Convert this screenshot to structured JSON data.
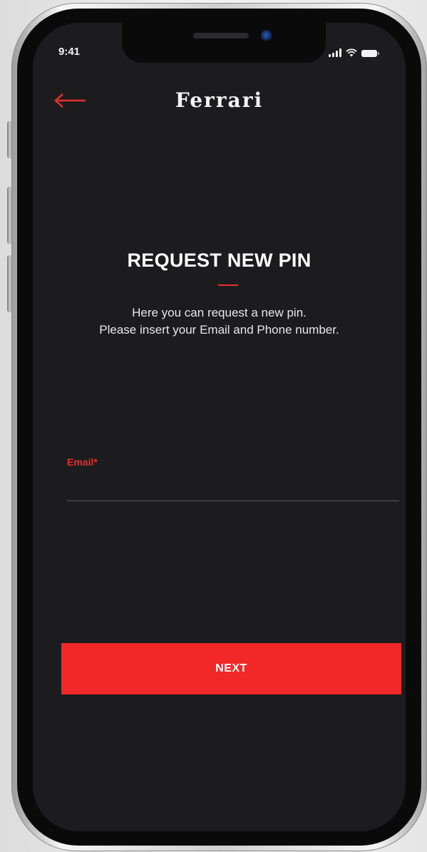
{
  "status_bar": {
    "time": "9:41",
    "icons": [
      "signal-icon",
      "wifi-icon",
      "battery-icon"
    ]
  },
  "header": {
    "back_icon": "arrow-left-icon",
    "logo_text": "Ferrari"
  },
  "main": {
    "title": "REQUEST NEW PIN",
    "subtitle_line1": "Here you can request a new pin.",
    "subtitle_line2": "Please insert your Email and Phone number."
  },
  "form": {
    "email_label": "Email*",
    "email_value": ""
  },
  "actions": {
    "next_label": "NEXT"
  },
  "colors": {
    "accent": "#f22727",
    "screen_background": "#1c1c1f",
    "label_red": "#e3312b"
  }
}
